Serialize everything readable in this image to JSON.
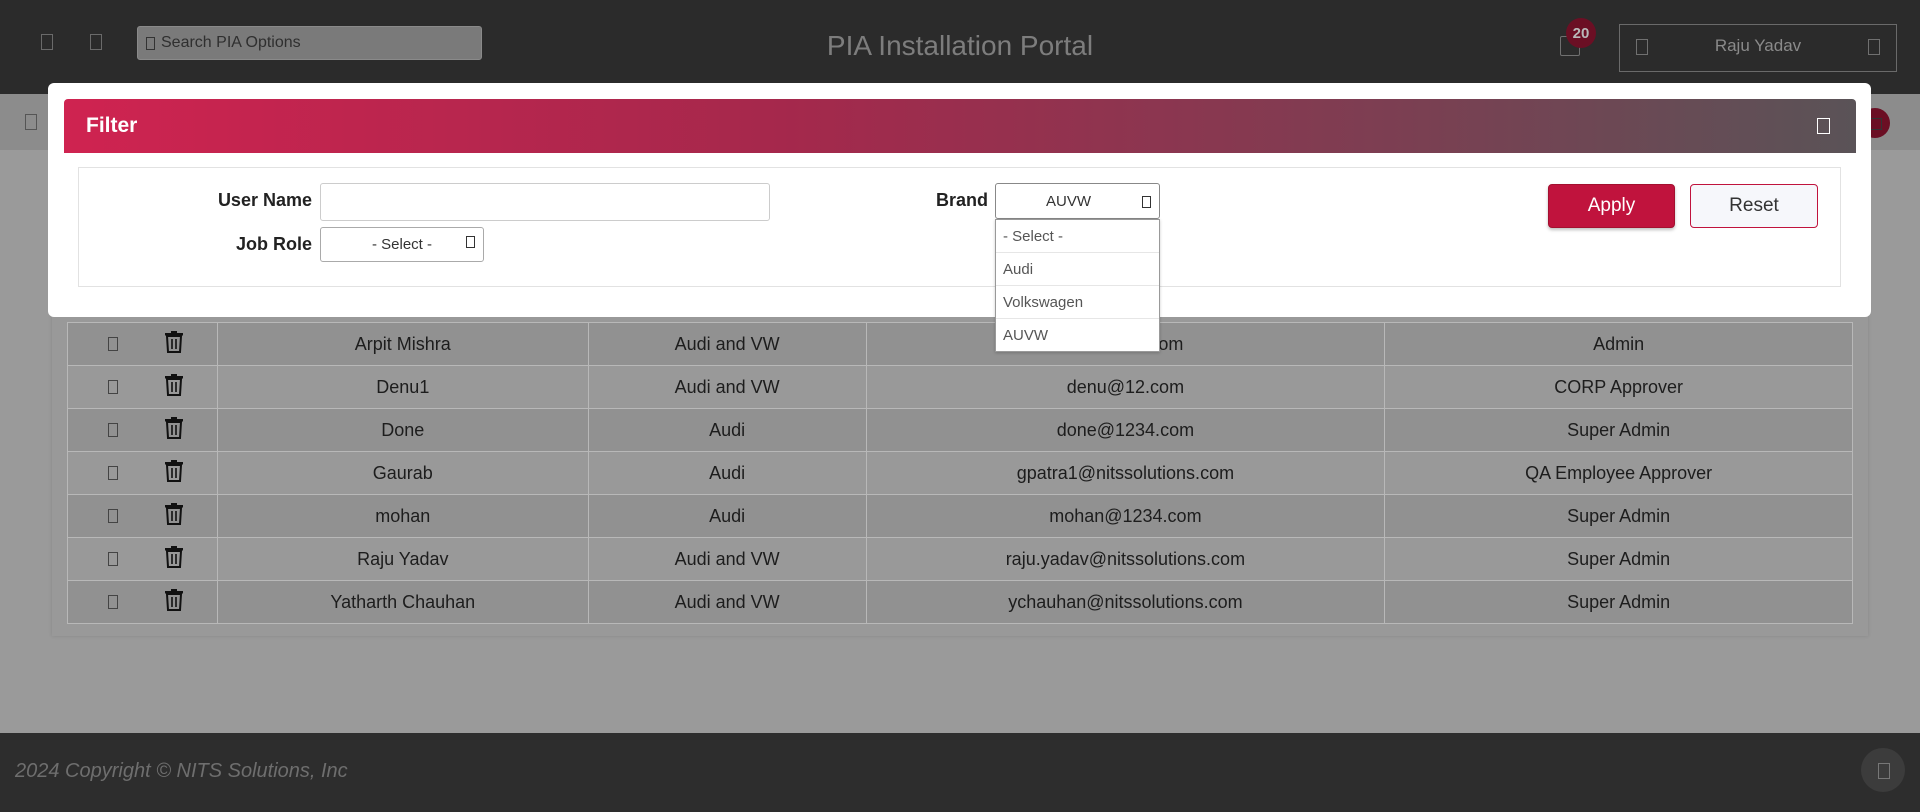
{
  "header": {
    "search_placeholder": "Search PIA Options",
    "title": "PIA Installation Portal",
    "notification_count": "20",
    "user_name": "Raju Yadav"
  },
  "table": {
    "rows": [
      {
        "name": "Arpit Mishra",
        "brand": "Audi and VW",
        "email": "...olutions.com",
        "role": "Admin"
      },
      {
        "name": "Denu1",
        "brand": "Audi and VW",
        "email": "denu@12.com",
        "role": "CORP Approver"
      },
      {
        "name": "Done",
        "brand": "Audi",
        "email": "done@1234.com",
        "role": "Super Admin"
      },
      {
        "name": "Gaurab",
        "brand": "Audi",
        "email": "gpatra1@nitssolutions.com",
        "role": "QA Employee Approver"
      },
      {
        "name": "mohan",
        "brand": "Audi",
        "email": "mohan@1234.com",
        "role": "Super Admin"
      },
      {
        "name": "Raju Yadav",
        "brand": "Audi and VW",
        "email": "raju.yadav@nitssolutions.com",
        "role": "Super Admin"
      },
      {
        "name": "Yatharth Chauhan",
        "brand": "Audi and VW",
        "email": "ychauhan@nitssolutions.com",
        "role": "Super Admin"
      }
    ]
  },
  "footer": {
    "copyright": "2024 Copyright © NITS Solutions, Inc"
  },
  "filter": {
    "title": "Filter",
    "user_name_label": "User Name",
    "user_name_value": "",
    "job_role_label": "Job Role",
    "job_role_value": "- Select -",
    "brand_label": "Brand",
    "brand_value": "AUVW",
    "brand_options": [
      "- Select -",
      "Audi",
      "Volkswagen",
      "AUVW"
    ],
    "apply_label": "Apply",
    "reset_label": "Reset"
  },
  "colors": {
    "accent": "#c0133d",
    "header_bg": "#2b2b2b",
    "overlay_bg": "#9a9a9a"
  }
}
